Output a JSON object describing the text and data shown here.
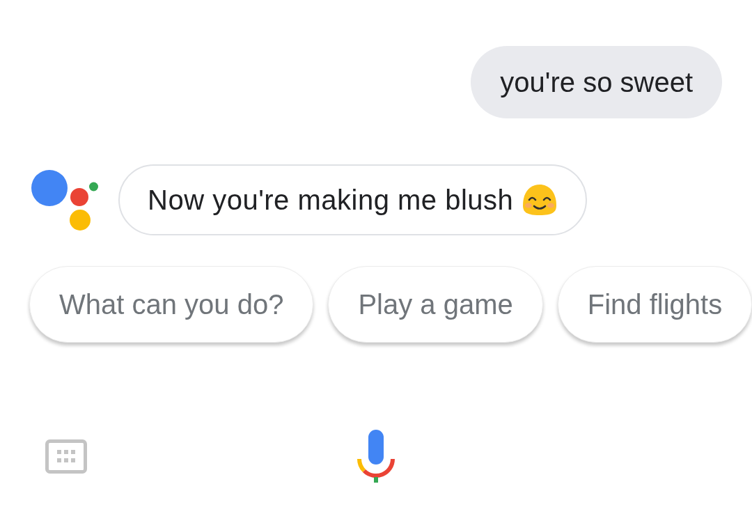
{
  "user_message": {
    "text": "you're so sweet"
  },
  "assistant_message": {
    "text": "Now you're making me blush"
  },
  "suggestions": [
    {
      "label": "What can you do?"
    },
    {
      "label": "Play a game"
    },
    {
      "label": "Find flights"
    }
  ]
}
